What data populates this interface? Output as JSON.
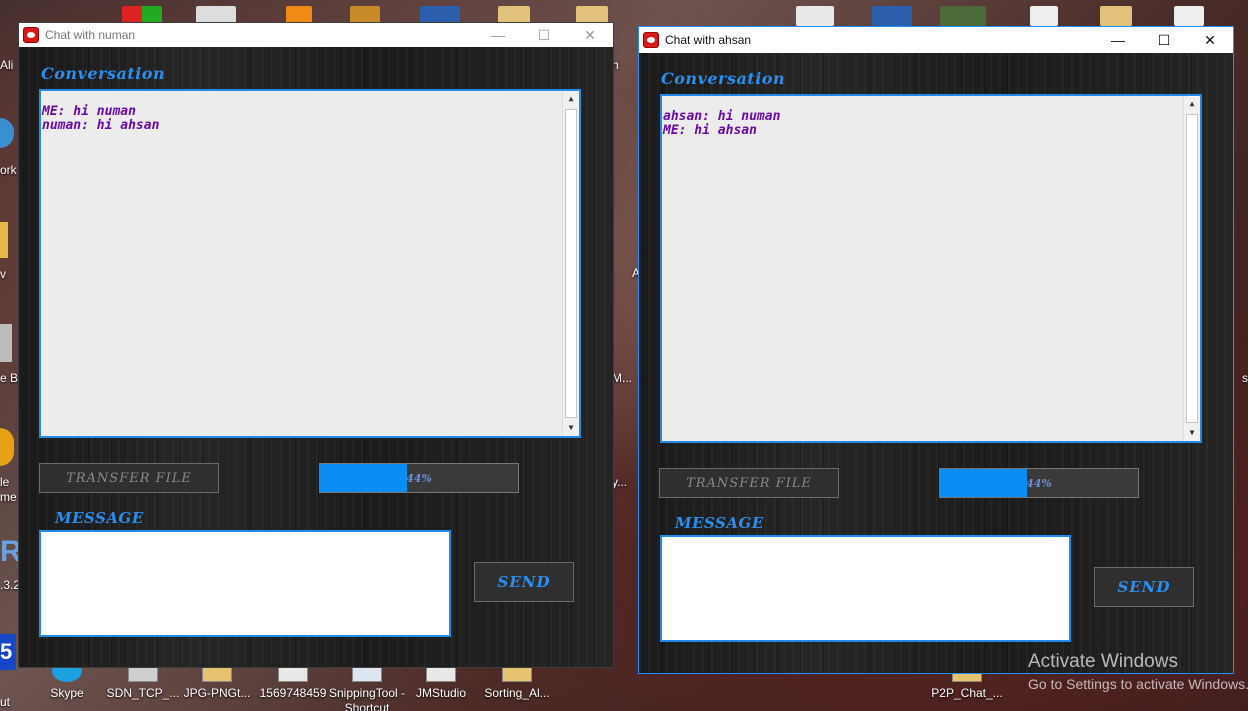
{
  "desktop": {
    "left_labels": [
      "Ali",
      "ork",
      "v",
      "e Bin",
      "le",
      "me",
      ".3.2",
      "ut"
    ],
    "mid_labels": [
      "h",
      "A",
      "M...",
      "y..."
    ],
    "right_labels": [
      "s"
    ],
    "bottom_icons": [
      {
        "label": "Skype"
      },
      {
        "label": "SDN_TCP_..."
      },
      {
        "label": "JPG-PNGt..."
      },
      {
        "label": "1569748459"
      },
      {
        "label": "SnippingTool - Shortcut"
      },
      {
        "label": "JMStudio"
      },
      {
        "label": "Sorting_Al..."
      },
      {
        "label": "P2P_Chat_..."
      }
    ]
  },
  "window_numan": {
    "title": "Chat with numan",
    "conversation_label": "Conversation",
    "conversation_lines": [
      "ME: hi numan",
      "numan: hi ahsan"
    ],
    "transfer_label": "TRANSFER FILE",
    "progress_percent": 44,
    "progress_text": "44%",
    "message_label": "MESSAGE",
    "message_value": "",
    "send_label": "SEND"
  },
  "window_ahsan": {
    "title": "Chat with ahsan",
    "conversation_label": "Conversation",
    "conversation_lines": [
      "ahsan: hi numan",
      "ME: hi ahsan"
    ],
    "transfer_label": "TRANSFER FILE",
    "progress_percent": 44,
    "progress_text": "44%",
    "message_label": "MESSAGE",
    "message_value": "",
    "send_label": "SEND"
  },
  "watermark": {
    "title": "Activate Windows",
    "subtitle": "Go to Settings to activate Windows."
  }
}
